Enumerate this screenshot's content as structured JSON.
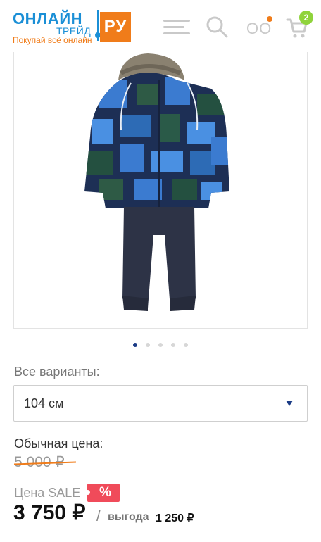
{
  "header": {
    "logo": {
      "main": "ОНЛАЙН",
      "sub": "ТРЕЙД",
      "box": "РУ",
      "tagline": "Покупай всё онлайн"
    },
    "icons": {
      "menu": "menu-icon",
      "search": "search-icon",
      "compare": "compare-icon",
      "cart": "cart-icon"
    },
    "compare_text": "OO",
    "cart_count": "2",
    "colors": {
      "brand_blue": "#1b8fd6",
      "brand_orange": "#f07c1a",
      "badge_green": "#8fd33b",
      "sale_red": "#f04b5a"
    }
  },
  "gallery": {
    "image_alt": "Детский зимний комплект: куртка с капюшоном и полукомбинезон",
    "slides_total": 5,
    "active_slide": 1
  },
  "variants": {
    "label": "Все варианты:",
    "selected": "104 см"
  },
  "pricing": {
    "regular_label": "Обычная цена:",
    "old_price": "5 000 ₽",
    "sale_label": "Цена SALE",
    "sale_badge": "%",
    "price": "3 750 ₽",
    "slash": "/",
    "benefit_label": "выгода",
    "benefit_value": "1 250 ₽"
  }
}
